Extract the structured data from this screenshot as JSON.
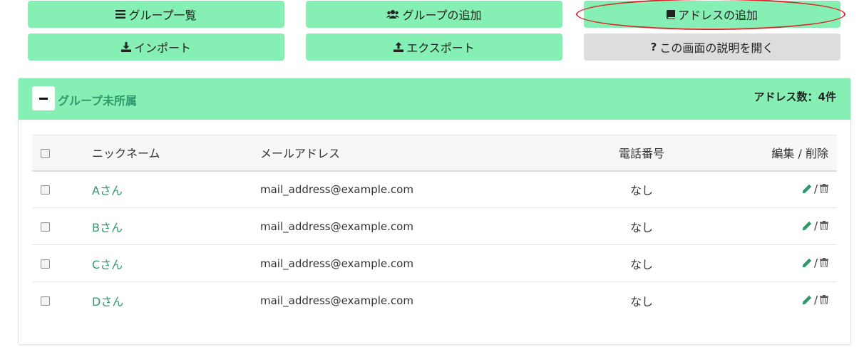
{
  "toolbar": {
    "group_list": {
      "label": "グループ一覧",
      "icon": "list-icon"
    },
    "add_group": {
      "label": "グループの追加",
      "icon": "users-icon"
    },
    "add_address": {
      "label": "アドレスの追加",
      "icon": "book-icon"
    },
    "import": {
      "label": "インポート",
      "icon": "download-icon"
    },
    "export": {
      "label": "エクスポート",
      "icon": "upload-icon"
    },
    "help": {
      "label": "この画面の説明を開く",
      "icon": "question-icon"
    }
  },
  "group": {
    "title": "グループ未所属",
    "count_label": "アドレス数：4件"
  },
  "table": {
    "headers": {
      "nickname": "ニックネーム",
      "email": "メールアドレス",
      "phone": "電話番号",
      "edit_delete": "編集 / 削除"
    },
    "rows": [
      {
        "nickname": "Aさん",
        "email": "mail_address@example.com",
        "phone": "なし"
      },
      {
        "nickname": "Bさん",
        "email": "mail_address@example.com",
        "phone": "なし"
      },
      {
        "nickname": "Cさん",
        "email": "mail_address@example.com",
        "phone": "なし"
      },
      {
        "nickname": "Dさん",
        "email": "mail_address@example.com",
        "phone": "なし"
      }
    ],
    "action_separator": "/"
  },
  "colors": {
    "accent_green": "#86efb3",
    "link_green": "#2e9a6b",
    "help_gray": "#dddddd",
    "highlight_red": "#d9262b"
  }
}
